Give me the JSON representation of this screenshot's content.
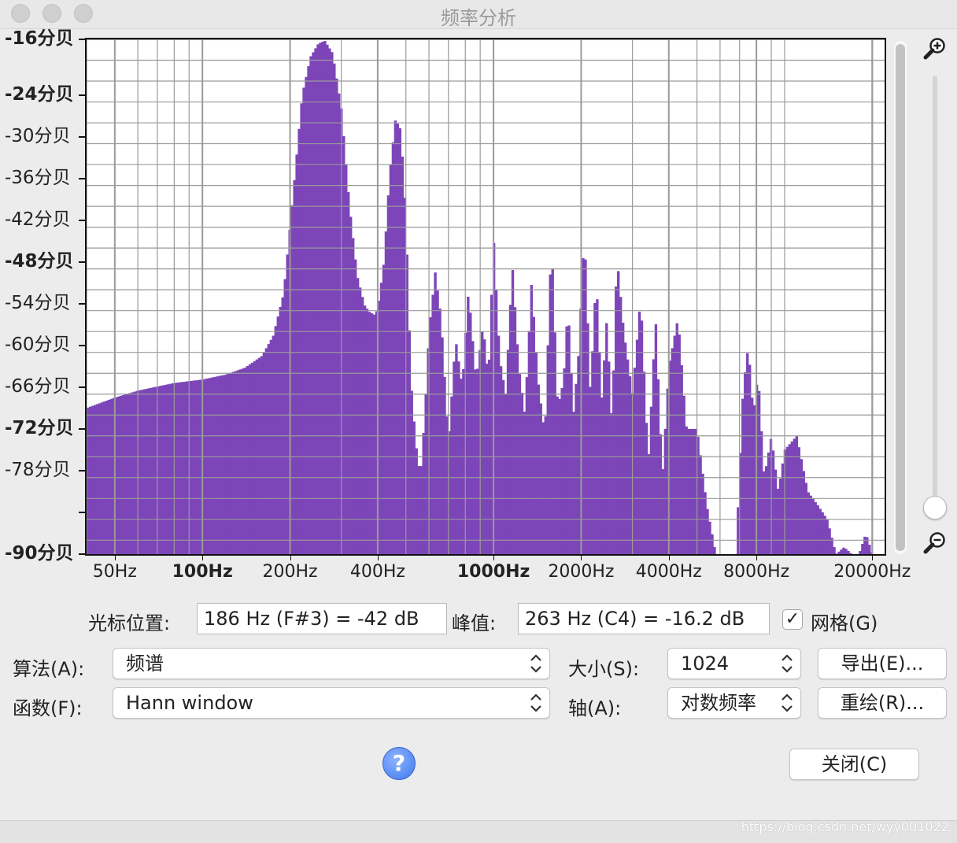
{
  "window": {
    "title": "频率分析"
  },
  "colors": {
    "spectrum": "#7c45b8",
    "grid": "#9a9a9a",
    "window_bg": "#ececec"
  },
  "y_axis": {
    "labels": [
      {
        "text": "-16分贝",
        "db": -16,
        "bold": true
      },
      {
        "text": "-24分贝",
        "db": -24,
        "bold": true
      },
      {
        "text": "-30分贝",
        "db": -30,
        "bold": false
      },
      {
        "text": "-36分贝",
        "db": -36,
        "bold": false
      },
      {
        "text": "-42分贝",
        "db": -42,
        "bold": false
      },
      {
        "text": "-48分贝",
        "db": -48,
        "bold": true
      },
      {
        "text": "-54分贝",
        "db": -54,
        "bold": false
      },
      {
        "text": "-60分贝",
        "db": -60,
        "bold": false
      },
      {
        "text": "-66分贝",
        "db": -66,
        "bold": false
      },
      {
        "text": "-72分贝",
        "db": -72,
        "bold": true
      },
      {
        "text": "-78分贝",
        "db": -78,
        "bold": false
      },
      {
        "text": "-90分贝",
        "db": -90,
        "bold": true
      }
    ]
  },
  "x_axis": {
    "labels": [
      {
        "text": "50Hz",
        "hz": 50,
        "bold": false
      },
      {
        "text": "100Hz",
        "hz": 100,
        "bold": true
      },
      {
        "text": "200Hz",
        "hz": 200,
        "bold": false
      },
      {
        "text": "400Hz",
        "hz": 400,
        "bold": false
      },
      {
        "text": "1000Hz",
        "hz": 1000,
        "bold": true
      },
      {
        "text": "2000Hz",
        "hz": 2000,
        "bold": false
      },
      {
        "text": "4000Hz",
        "hz": 4000,
        "bold": false
      },
      {
        "text": "8000Hz",
        "hz": 8000,
        "bold": false
      },
      {
        "text": "20000Hz",
        "hz": 20000,
        "bold": false
      }
    ]
  },
  "chart_data": {
    "type": "area",
    "x_scale": "log",
    "xlim": [
      40,
      22050
    ],
    "ylim": [
      -90,
      -16
    ],
    "grid": true,
    "x_unit": "Hz",
    "y_unit": "dB",
    "series": [
      {
        "x": [
          40,
          50,
          60,
          70,
          80,
          100,
          120,
          140,
          160,
          175,
          190,
          205,
          220,
          235,
          250,
          263,
          280,
          300,
          320,
          340,
          360,
          375,
          390,
          400,
          420,
          440,
          460,
          480,
          500,
          520,
          540,
          560,
          580,
          600,
          630,
          660,
          700,
          740,
          780,
          820,
          870,
          920,
          960,
          1000,
          1050,
          1100,
          1160,
          1220,
          1280,
          1350,
          1420,
          1500,
          1580,
          1660,
          1740,
          1800,
          1880,
          1960,
          2050,
          2150,
          2250,
          2350,
          2450,
          2550,
          2650,
          2800,
          3000,
          3200,
          3400,
          3600,
          3800,
          4000,
          4300,
          4600,
          5000,
          5400,
          5800,
          6300,
          6800,
          7200,
          7500,
          7800,
          8100,
          8500,
          9000,
          9500,
          10000,
          11000,
          12000,
          13000,
          14000,
          15000,
          16000,
          17000,
          18000,
          19000,
          20000,
          21000,
          22050
        ],
        "y": [
          -69,
          -67.5,
          -66.5,
          -65.9,
          -65.4,
          -64.9,
          -64.2,
          -63.2,
          -61.5,
          -58.6,
          -52.5,
          -38,
          -24,
          -18.5,
          -16.6,
          -16.2,
          -18,
          -26,
          -40,
          -50,
          -54.2,
          -55.2,
          -55.6,
          -54.8,
          -48,
          -35,
          -27.5,
          -29,
          -42,
          -65,
          -74,
          -79,
          -70,
          -58,
          -49.5,
          -56,
          -74,
          -59,
          -66,
          -52,
          -65,
          -57,
          -65,
          -44.5,
          -62,
          -67,
          -48.5,
          -63,
          -70,
          -51,
          -65,
          -73,
          -44.5,
          -69,
          -65,
          -54,
          -70,
          -61,
          -43.5,
          -67,
          -50,
          -68,
          -56,
          -72,
          -47,
          -58,
          -67,
          -53,
          -77,
          -56,
          -79,
          -63,
          -56,
          -72,
          -72,
          -83,
          -90,
          -90,
          -90,
          -66,
          -60,
          -70,
          -64,
          -79,
          -73,
          -81,
          -75,
          -73,
          -81,
          -83,
          -85,
          -90,
          -89,
          -90,
          -90,
          -87,
          -90,
          -90,
          -90
        ]
      }
    ]
  },
  "controls": {
    "cursor_label": "光标位置:",
    "cursor_value": "186 Hz (F#3) = -42 dB",
    "peak_label": "峰值:",
    "peak_value": "263 Hz (C4) = -16.2 dB",
    "grid_checkbox_label": "网格(G)",
    "grid_checked": true,
    "algorithm_label": "算法(A):",
    "algorithm_value": "频谱",
    "function_label": "函数(F):",
    "function_value": "Hann window",
    "size_label": "大小(S):",
    "size_value": "1024",
    "axis_label": "轴(A):",
    "axis_value": "对数频率",
    "export_button": "导出(E)...",
    "replot_button": "重绘(R)...",
    "close_button": "关闭(C)",
    "help_glyph": "?",
    "checkmark_glyph": "✓"
  },
  "watermark": "https://blog.csdn.net/wyy001022"
}
